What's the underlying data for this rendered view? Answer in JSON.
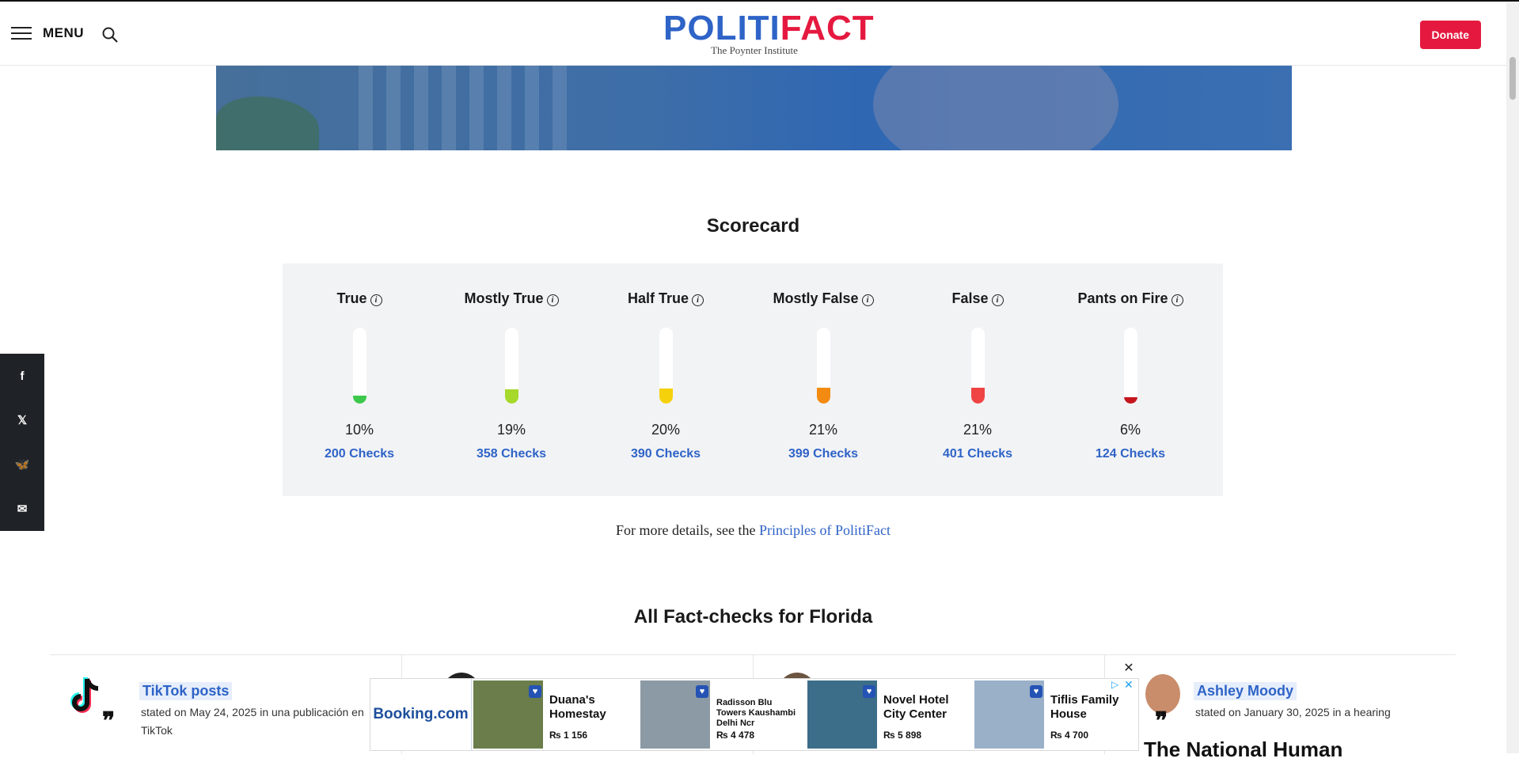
{
  "header": {
    "menu_label": "MENU",
    "logo_part1": "POLITI",
    "logo_part2": "FACT",
    "logo_sub": "The Poynter Institute",
    "donate_label": "Donate"
  },
  "share": [
    "f",
    "𝕏",
    "🦋",
    "✉"
  ],
  "scorecard": {
    "title": "Scorecard",
    "items": [
      {
        "name": "True",
        "percent": "10%",
        "checks": "200 Checks",
        "fill_fraction": 0.1,
        "color": "#3cc84a"
      },
      {
        "name": "Mostly True",
        "percent": "19%",
        "checks": "358 Checks",
        "fill_fraction": 0.19,
        "color": "#a6d92b"
      },
      {
        "name": "Half True",
        "percent": "20%",
        "checks": "390 Checks",
        "fill_fraction": 0.2,
        "color": "#f5d10c"
      },
      {
        "name": "Mostly False",
        "percent": "21%",
        "checks": "399 Checks",
        "fill_fraction": 0.21,
        "color": "#f38a12"
      },
      {
        "name": "False",
        "percent": "21%",
        "checks": "401 Checks",
        "fill_fraction": 0.21,
        "color": "#ef4444"
      },
      {
        "name": "Pants on Fire",
        "percent": "6%",
        "checks": "124 Checks",
        "fill_fraction": 0.06,
        "color": "#c4171d"
      }
    ]
  },
  "principles": {
    "prefix": "For more details, see the ",
    "link": "Principles of PolitiFact"
  },
  "factchecks": {
    "title": "All Fact-checks for Florida",
    "card1": {
      "speaker": "TikTok posts",
      "stated_line1": "stated on May 24, 2025 in una publicación en",
      "stated_line2": "TikTok"
    },
    "card4": {
      "speaker": "Ashley Moody",
      "stated_line1": "stated on January 30, 2025 in a hearing",
      "title": "The National Human"
    }
  },
  "ad": {
    "brand": "Booking.com",
    "close": "✕",
    "hotels": [
      {
        "name": "Duana's Homestay",
        "price": "₨ 1 156",
        "color": "#6a7d4a"
      },
      {
        "name": "Radisson Blu Towers Kaushambi Delhi Ncr",
        "price": "₨ 4 478",
        "color": "#8c9aa5"
      },
      {
        "name": "Novel Hotel City Center",
        "price": "₨ 5 898",
        "color": "#3c6e8a"
      },
      {
        "name": "Tiflis Family House",
        "price": "₨ 4 700",
        "color": "#9ab0c9"
      }
    ]
  }
}
